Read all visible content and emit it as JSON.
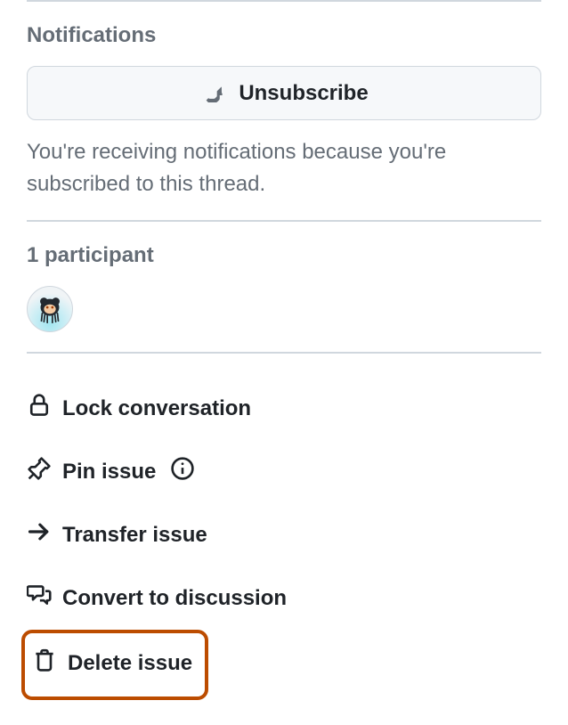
{
  "notifications": {
    "heading": "Notifications",
    "button_label": "Unsubscribe",
    "note": "You're receiving notifications because you're subscribed to this thread."
  },
  "participants": {
    "heading": "1 participant"
  },
  "actions": {
    "lock": "Lock conversation",
    "pin": "Pin issue",
    "transfer": "Transfer issue",
    "convert": "Convert to discussion",
    "delete": "Delete issue"
  }
}
